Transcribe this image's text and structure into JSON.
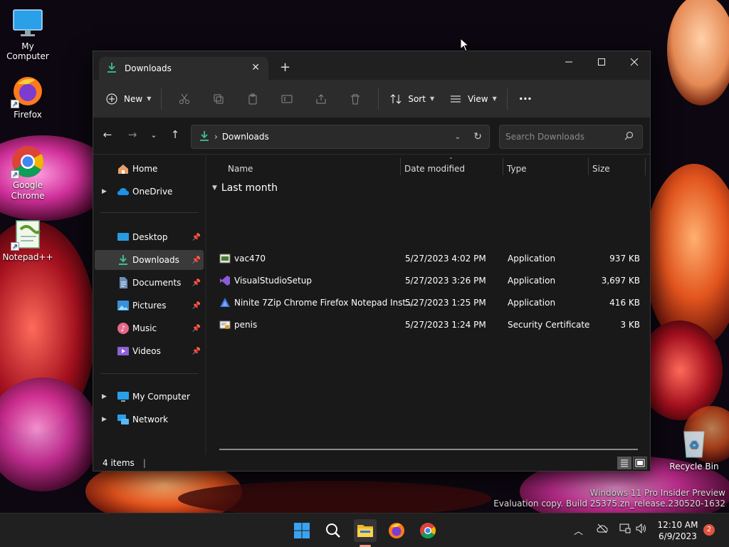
{
  "desktop": {
    "icons": [
      {
        "label": "My Computer"
      },
      {
        "label": "Firefox"
      },
      {
        "label": "Google Chrome"
      },
      {
        "label": "Notepad++"
      },
      {
        "label": "Recycle Bin"
      }
    ],
    "watermark": {
      "line1": "Windows 11 Pro Insider Preview",
      "line2": "Evaluation copy. Build 25375.zn_release.230520-1632"
    }
  },
  "window": {
    "tab": {
      "title": "Downloads"
    },
    "toolbar": {
      "new_label": "New",
      "sort_label": "Sort",
      "view_label": "View",
      "more_label": "···"
    },
    "address": {
      "path": "Downloads",
      "search_placeholder": "Search Downloads"
    },
    "sidebar": {
      "items": [
        {
          "label": "Home"
        },
        {
          "label": "OneDrive"
        },
        {
          "label": "Desktop"
        },
        {
          "label": "Downloads"
        },
        {
          "label": "Documents"
        },
        {
          "label": "Pictures"
        },
        {
          "label": "Music"
        },
        {
          "label": "Videos"
        },
        {
          "label": "My Computer"
        },
        {
          "label": "Network"
        }
      ]
    },
    "columns": {
      "name": "Name",
      "date": "Date modified",
      "type": "Type",
      "size": "Size"
    },
    "group": {
      "label": "Last month"
    },
    "files": [
      {
        "name": "vac470",
        "date": "5/27/2023 4:02 PM",
        "type": "Application",
        "size": "937 KB"
      },
      {
        "name": "VisualStudioSetup",
        "date": "5/27/2023 3:26 PM",
        "type": "Application",
        "size": "3,697 KB"
      },
      {
        "name": "Ninite 7Zip Chrome Firefox Notepad Inst...",
        "date": "5/27/2023 1:25 PM",
        "type": "Application",
        "size": "416 KB"
      },
      {
        "name": "penis",
        "date": "5/27/2023 1:24 PM",
        "type": "Security Certificate",
        "size": "3 KB"
      }
    ],
    "status": {
      "count": "4 items"
    }
  },
  "taskbar": {
    "time": "12:10 AM",
    "date": "6/9/2023",
    "notification_count": "2"
  },
  "colors": {
    "accent_green": "#3fbf8f",
    "window_bg": "#191919",
    "toolbar_bg": "#2c2c2c",
    "selection_bg": "#3a3a3a",
    "badge": "#e0533f"
  }
}
